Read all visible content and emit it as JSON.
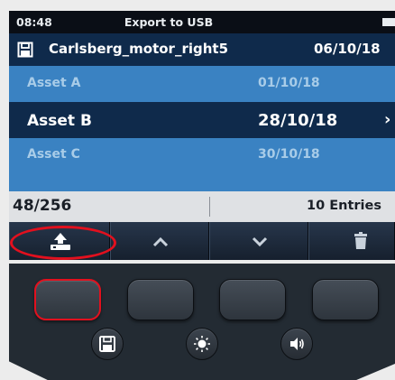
{
  "status": {
    "time": "08:48",
    "title": "Export to USB"
  },
  "file": {
    "name": "Carlsberg_motor_right5",
    "date": "06/10/18"
  },
  "assets": [
    {
      "label": "Asset A",
      "date": "01/10/18",
      "state": "faded"
    },
    {
      "label": "Asset B",
      "date": "28/10/18",
      "state": "selected",
      "chevron": "›"
    },
    {
      "label": "Asset C",
      "date": "30/10/18",
      "state": "faded"
    }
  ],
  "info": {
    "count": "48/256",
    "entries": "10 Entries"
  },
  "softkeys": [
    {
      "icon": "upload-to-usb-icon",
      "highlighted": true
    },
    {
      "icon": "chevron-up-icon"
    },
    {
      "icon": "chevron-down-icon"
    },
    {
      "icon": "trash-icon"
    }
  ],
  "hardware_round_buttons": [
    "save-icon",
    "brightness-icon",
    "volume-icon"
  ],
  "colors": {
    "accent_highlight": "#e2101e",
    "header_blue": "#0f2a4b",
    "row_faded_blue": "#3a82c2"
  }
}
